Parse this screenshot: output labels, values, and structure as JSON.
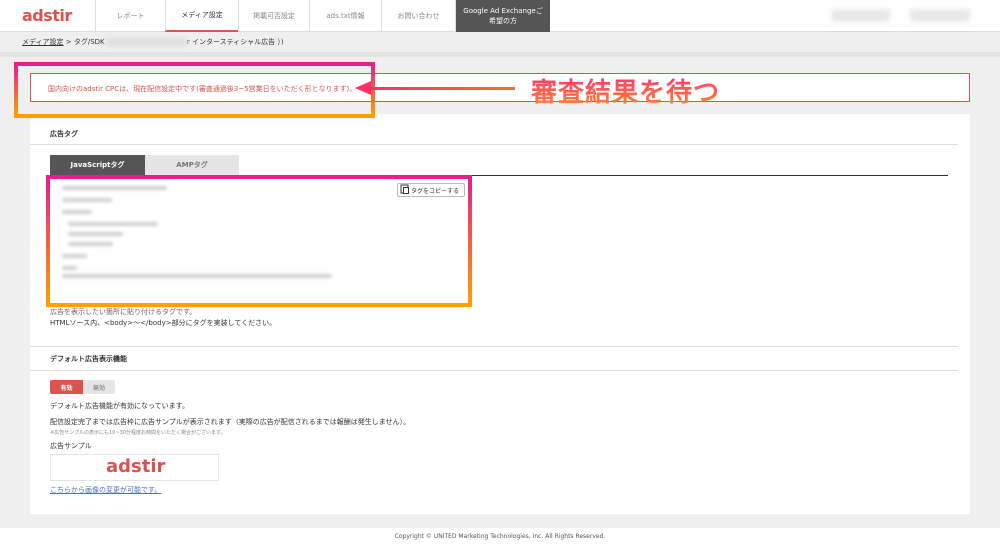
{
  "header": {
    "logo": "adstir",
    "nav": [
      {
        "label": "レポート"
      },
      {
        "label": "メディア設定"
      },
      {
        "label": "掲載可否設定"
      },
      {
        "label": "ads.txt情報"
      },
      {
        "label": "お問い合わせ"
      },
      {
        "label": "Google Ad Exchangeご希望の方"
      }
    ]
  },
  "breadcrumb": {
    "link": "メディア設定",
    "middle": " > タグ/SDK ",
    "suffix": "r インタースティシャル広告 ）)"
  },
  "alert": {
    "text": "国内向けのadstir CPCは、現在配信設定中です(審査通過後3~5営業日をいただく形となります)。"
  },
  "annotation": {
    "label": "審査結果を待つ"
  },
  "ad_tag": {
    "section_title": "広告タグ",
    "tabs": [
      {
        "label": "JavaScriptタグ"
      },
      {
        "label": "AMPタグ"
      }
    ],
    "copy_button": "タグをコピーする",
    "instructions": [
      "広告を表示したい箇所に貼り付けるタグです。",
      "HTMLソース内、<body>〜</body>部分にタグを実装してください。"
    ]
  },
  "default_ad": {
    "section_title": "デフォルト広告表示機能",
    "toggle_on": "有効",
    "toggle_off": "無効",
    "status": "デフォルト広告機能が有効になっています。",
    "description": "配信設定完了までは広告枠に広告サンプルが表示されます（実際の広告が配信されるまでは報酬は発生しません）。",
    "note": "※広告サンプルの表示にも10~30分程度お時間をいただく場合がございます。",
    "sample_label": "広告サンプル",
    "sample_logo": "adstir",
    "change_link": "こちらから画像の変更が可能です。"
  },
  "footer": {
    "copyright": "Copyright © UNITED Marketing Technologies, Inc. All Rights Reserved."
  }
}
